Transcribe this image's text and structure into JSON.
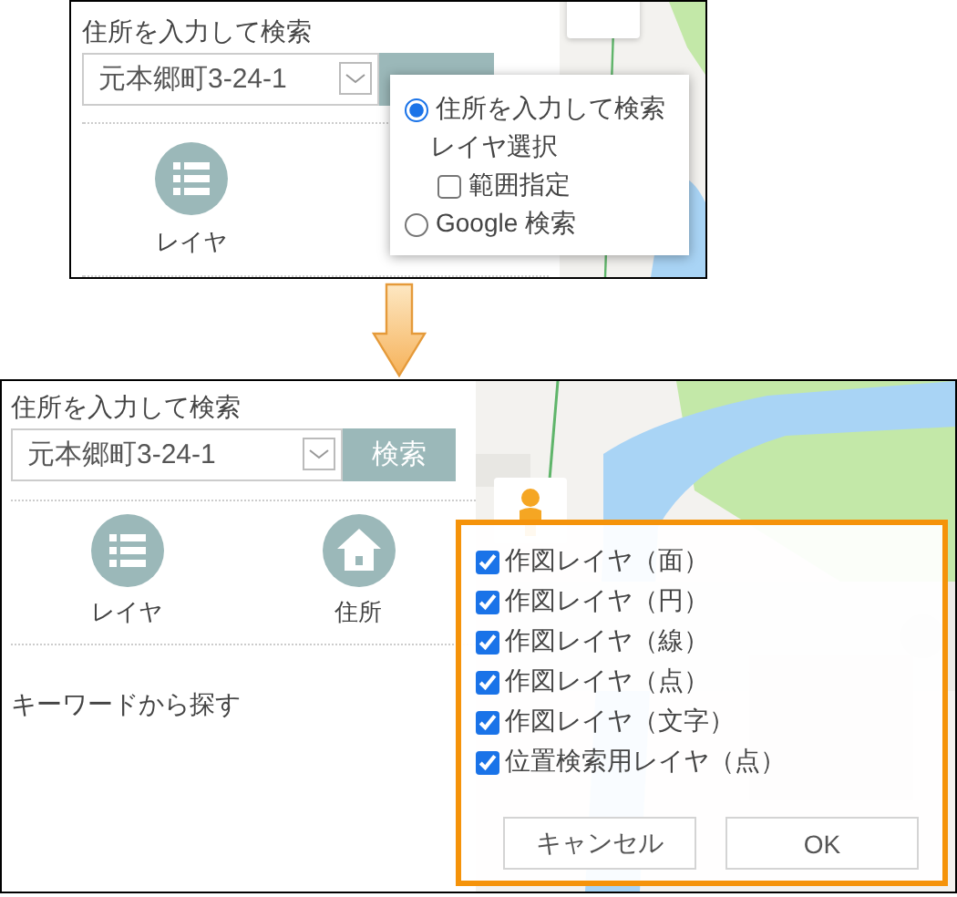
{
  "top_panel": {
    "search_label": "住所を入力して検索",
    "address_value": "元本郷町3-24-1",
    "tool_label": "レイヤ",
    "menu": [
      {
        "kind": "radio",
        "label": "住所を入力して検索",
        "selected": true
      },
      {
        "kind": "heading",
        "label": "レイヤ選択"
      },
      {
        "kind": "checkbox",
        "label": "範囲指定",
        "checked": false
      },
      {
        "kind": "radio",
        "label": "Google 検索",
        "selected": false
      }
    ]
  },
  "bottom_panel": {
    "search_label": "住所を入力して検索",
    "address_value": "元本郷町3-24-1",
    "search_button": "検索",
    "tools": [
      {
        "kind": "list",
        "label": "レイヤ"
      },
      {
        "kind": "home",
        "label": "住所"
      }
    ],
    "keyword_label": "キーワードから探す",
    "layers": [
      {
        "label": "作図レイヤ（面）",
        "checked": true
      },
      {
        "label": "作図レイヤ（円）",
        "checked": true
      },
      {
        "label": "作図レイヤ（線）",
        "checked": true
      },
      {
        "label": "作図レイヤ（点）",
        "checked": true
      },
      {
        "label": "作図レイヤ（文字）",
        "checked": true
      },
      {
        "label": "位置検索用レイヤ（点）",
        "checked": true
      }
    ],
    "buttons": [
      {
        "label": "キャンセル"
      },
      {
        "label": "OK"
      }
    ]
  }
}
